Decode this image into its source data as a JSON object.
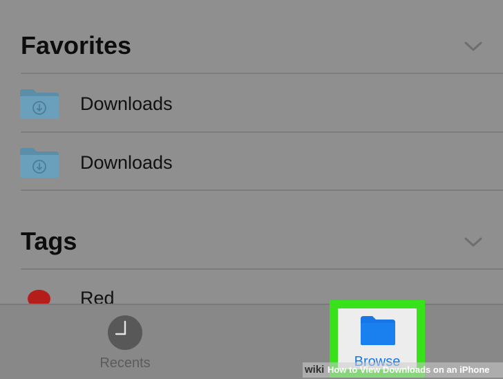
{
  "favorites": {
    "title": "Favorites",
    "chevron_icon": "chevron-down-icon",
    "items": [
      {
        "label": "Downloads",
        "icon": "downloads-folder-icon"
      },
      {
        "label": "Downloads",
        "icon": "downloads-folder-icon"
      }
    ]
  },
  "tags": {
    "title": "Tags",
    "chevron_icon": "chevron-down-icon",
    "items": [
      {
        "label": "Red",
        "color": "#b51d1a"
      }
    ]
  },
  "tab_bar": {
    "recents_label": "Recents",
    "recents_icon": "clock-icon",
    "browse_label": "Browse",
    "browse_icon": "folder-icon",
    "active_tab": "Browse",
    "highlight_color": "#37e21a",
    "active_color": "#1877e6"
  },
  "watermark": {
    "brand": "wiki",
    "title": "How to View Downloads on an iPhone"
  }
}
